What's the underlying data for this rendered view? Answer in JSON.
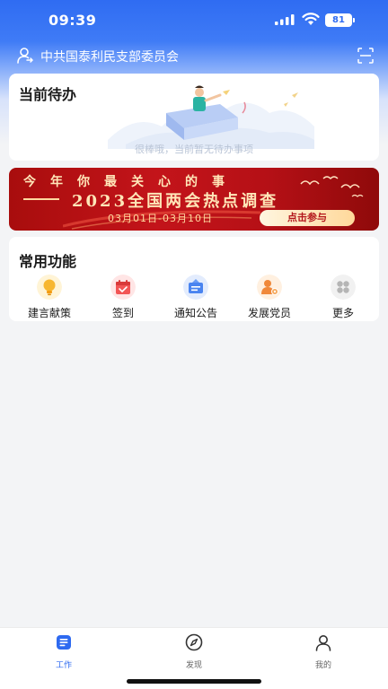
{
  "status_bar": {
    "time": "09:39",
    "battery": "81"
  },
  "header": {
    "org_name": "中共国泰利民支部委员会"
  },
  "todo": {
    "title": "当前待办",
    "empty_text": "很棒哦，当前暂无待办事项"
  },
  "banner": {
    "line1": "今年你最关心的事",
    "line2": "2023全国两会热点调查",
    "date_range": "03月01日-03月10日",
    "cta": "点击参与"
  },
  "functions": {
    "title": "常用功能",
    "items": [
      {
        "label": "建言献策",
        "icon": "lightbulb-icon"
      },
      {
        "label": "签到",
        "icon": "calendar-icon"
      },
      {
        "label": "通知公告",
        "icon": "announcement-icon"
      },
      {
        "label": "发展党员",
        "icon": "person-settings-icon"
      },
      {
        "label": "更多",
        "icon": "more-icon"
      }
    ]
  },
  "tabbar": {
    "tabs": [
      {
        "label": "工作",
        "icon": "document-icon",
        "active": true
      },
      {
        "label": "发现",
        "icon": "compass-icon"
      },
      {
        "label": "我的",
        "icon": "user-icon"
      }
    ]
  },
  "colors": {
    "primary": "#2e6af0",
    "banner_red": "#c3141a",
    "banner_gold": "#ffe6b8"
  }
}
